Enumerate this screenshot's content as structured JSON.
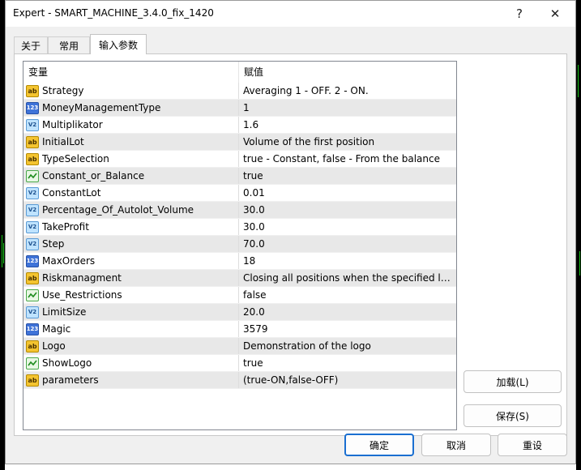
{
  "window": {
    "title": "Expert - SMART_MACHINE_3.4.0_fix_1420",
    "help_glyph": "?",
    "close_glyph": "✕"
  },
  "tabs": [
    {
      "label": "关于",
      "active": false
    },
    {
      "label": "常用",
      "active": false
    },
    {
      "label": "输入参数",
      "active": true
    }
  ],
  "table": {
    "columns": [
      "变量",
      "赋值"
    ],
    "rows": [
      {
        "icon": "string-icon",
        "name": "Strategy",
        "value": "Averaging 1 - OFF. 2 - ON."
      },
      {
        "icon": "integer-icon",
        "name": "MoneyManagementType",
        "value": "1"
      },
      {
        "icon": "double-icon",
        "name": "Multiplikator",
        "value": "1.6"
      },
      {
        "icon": "string-icon",
        "name": "InitialLot",
        "value": "Volume of the first position"
      },
      {
        "icon": "string-icon",
        "name": "TypeSelection",
        "value": "true - Constant, false - From the balance"
      },
      {
        "icon": "boolean-icon",
        "name": "Constant_or_Balance",
        "value": "true"
      },
      {
        "icon": "double-icon",
        "name": "ConstantLot",
        "value": "0.01"
      },
      {
        "icon": "double-icon",
        "name": "Percentage_Of_Autolot_Volume",
        "value": "30.0"
      },
      {
        "icon": "double-icon",
        "name": "TakeProfit",
        "value": "30.0"
      },
      {
        "icon": "double-icon",
        "name": "Step",
        "value": "70.0"
      },
      {
        "icon": "integer-icon",
        "name": "MaxOrders",
        "value": "18"
      },
      {
        "icon": "string-icon",
        "name": "Riskmanagment",
        "value": "Closing all positions when the specified lev..."
      },
      {
        "icon": "boolean-icon",
        "name": "Use_Restrictions",
        "value": "false"
      },
      {
        "icon": "double-icon",
        "name": "LimitSize",
        "value": "20.0"
      },
      {
        "icon": "integer-icon",
        "name": "Magic",
        "value": "3579"
      },
      {
        "icon": "string-icon",
        "name": "Logo",
        "value": "Demonstration of the logo"
      },
      {
        "icon": "boolean-icon",
        "name": "ShowLogo",
        "value": "true"
      },
      {
        "icon": "string-icon",
        "name": "parameters",
        "value": "(true-ON,false-OFF)"
      }
    ]
  },
  "icon_glyphs": {
    "string-icon": "ab",
    "integer-icon": "123",
    "double-icon": "V2"
  },
  "buttons": {
    "load": "加载(L)",
    "save": "保存(S)",
    "ok": "确定",
    "cancel": "取消",
    "reset": "重设"
  },
  "colors": {
    "accent": "#1a6fd1",
    "chart_green": "#17c417"
  }
}
